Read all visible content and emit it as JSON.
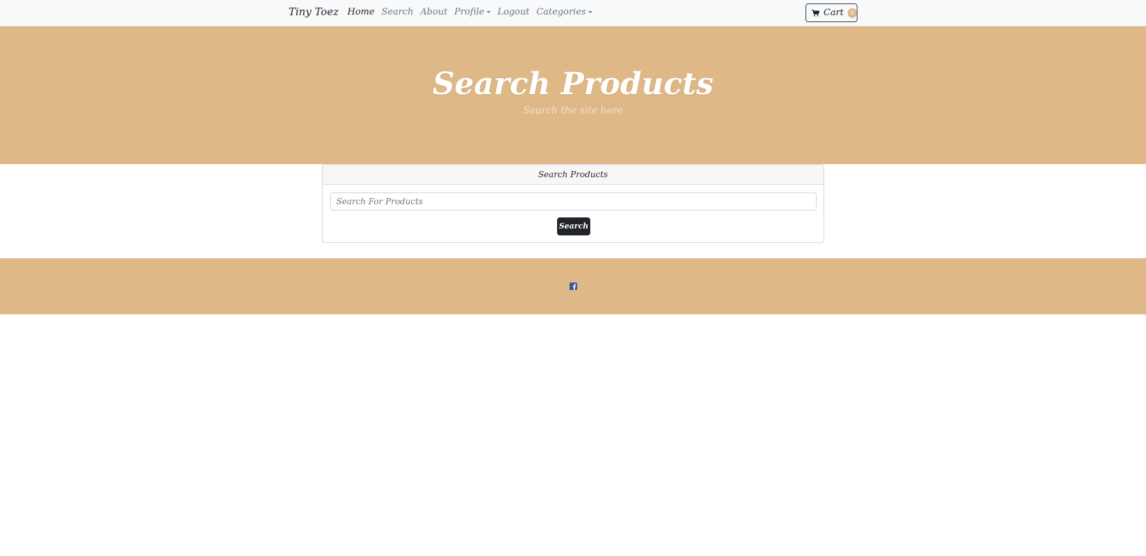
{
  "navbar": {
    "brand": "Tiny Toez",
    "links": [
      {
        "label": "Home"
      },
      {
        "label": "Search"
      },
      {
        "label": "About"
      },
      {
        "label": "Profile"
      },
      {
        "label": "Logout"
      },
      {
        "label": "Categories"
      }
    ],
    "cart": {
      "label": "Cart",
      "count": "0",
      "icon": "cart-icon"
    }
  },
  "hero": {
    "title": "Search Products",
    "subtitle": "Search the site here"
  },
  "search_card": {
    "header": "Search Products",
    "input_placeholder": "Search For Products",
    "input_value": "",
    "button_label": "Search"
  },
  "footer": {
    "icons": [
      "facebook-icon"
    ]
  },
  "colors": {
    "accent": "#deb887",
    "navbar_bg": "#f8f9fa",
    "button_dark": "#212529",
    "facebook": "#3b5998"
  }
}
